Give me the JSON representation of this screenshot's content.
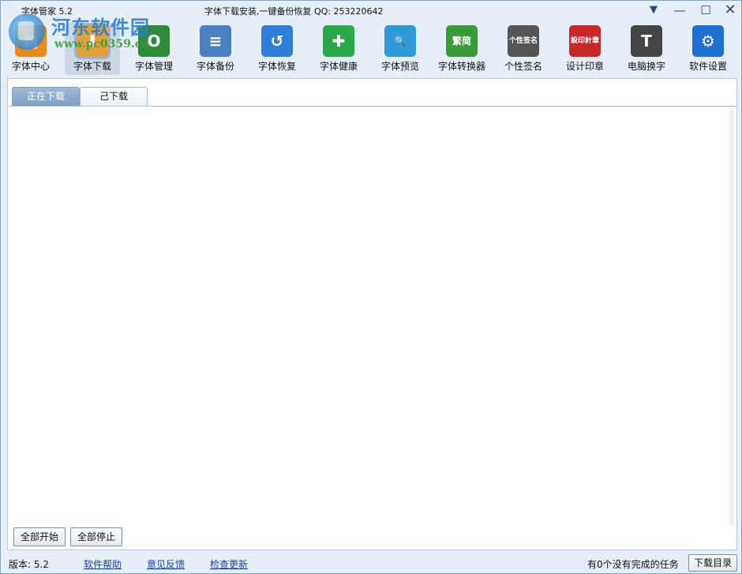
{
  "window": {
    "title": "字体管家 5.2",
    "slogan": "字体下载安装,一键备份恢复 QQ: 253220642",
    "controls": {
      "menu": "▼",
      "minimize": "—",
      "maximize": "☐",
      "close": "✕"
    }
  },
  "watermark": {
    "name": "河东软件园",
    "url": "www.pc0359.cn"
  },
  "toolbar": [
    {
      "label": "字体中心",
      "icon": "font-center-icon",
      "glyph": "▦",
      "color": "#e98a1f"
    },
    {
      "label": "字体下载",
      "icon": "font-download-icon",
      "glyph": "⬇",
      "color": "#e0a23a",
      "active": true
    },
    {
      "label": "字体管理",
      "icon": "font-manage-icon",
      "glyph": "O",
      "color": "#2c8c3c"
    },
    {
      "label": "字体备份",
      "icon": "font-backup-icon",
      "glyph": "≡",
      "color": "#4a7fc1"
    },
    {
      "label": "字体恢复",
      "icon": "font-restore-icon",
      "glyph": "↺",
      "color": "#2f7fd6"
    },
    {
      "label": "字体健康",
      "icon": "font-health-icon",
      "glyph": "✚",
      "color": "#2aa84a"
    },
    {
      "label": "字体预览",
      "icon": "font-preview-icon",
      "glyph": "🔍",
      "color": "#2e9ad8"
    },
    {
      "label": "字体转换器",
      "icon": "font-converter-icon",
      "glyph": "繁简",
      "color": "#3a9a3a"
    },
    {
      "label": "个性签名",
      "icon": "signature-icon",
      "glyph": "个性签名",
      "color": "#555555"
    },
    {
      "label": "设计印章",
      "icon": "seal-icon",
      "glyph": "設印計章",
      "color": "#c62828"
    },
    {
      "label": "电脑换字",
      "icon": "computer-font-icon",
      "glyph": "T",
      "color": "#444444"
    },
    {
      "label": "软件设置",
      "icon": "settings-gear-icon",
      "glyph": "⚙",
      "color": "#1f6fd0"
    }
  ],
  "tabs": [
    {
      "label": "正在下载",
      "active": true
    },
    {
      "label": "己下载",
      "active": false
    }
  ],
  "actions": {
    "start_all": "全部开始",
    "stop_all": "全部停止"
  },
  "status": {
    "version": "版本: 5.2",
    "help": "软件帮助",
    "feedback": "意见反馈",
    "update": "检查更新",
    "tasks": "有0个没有完成的任务",
    "download_dir": "下载目录"
  }
}
